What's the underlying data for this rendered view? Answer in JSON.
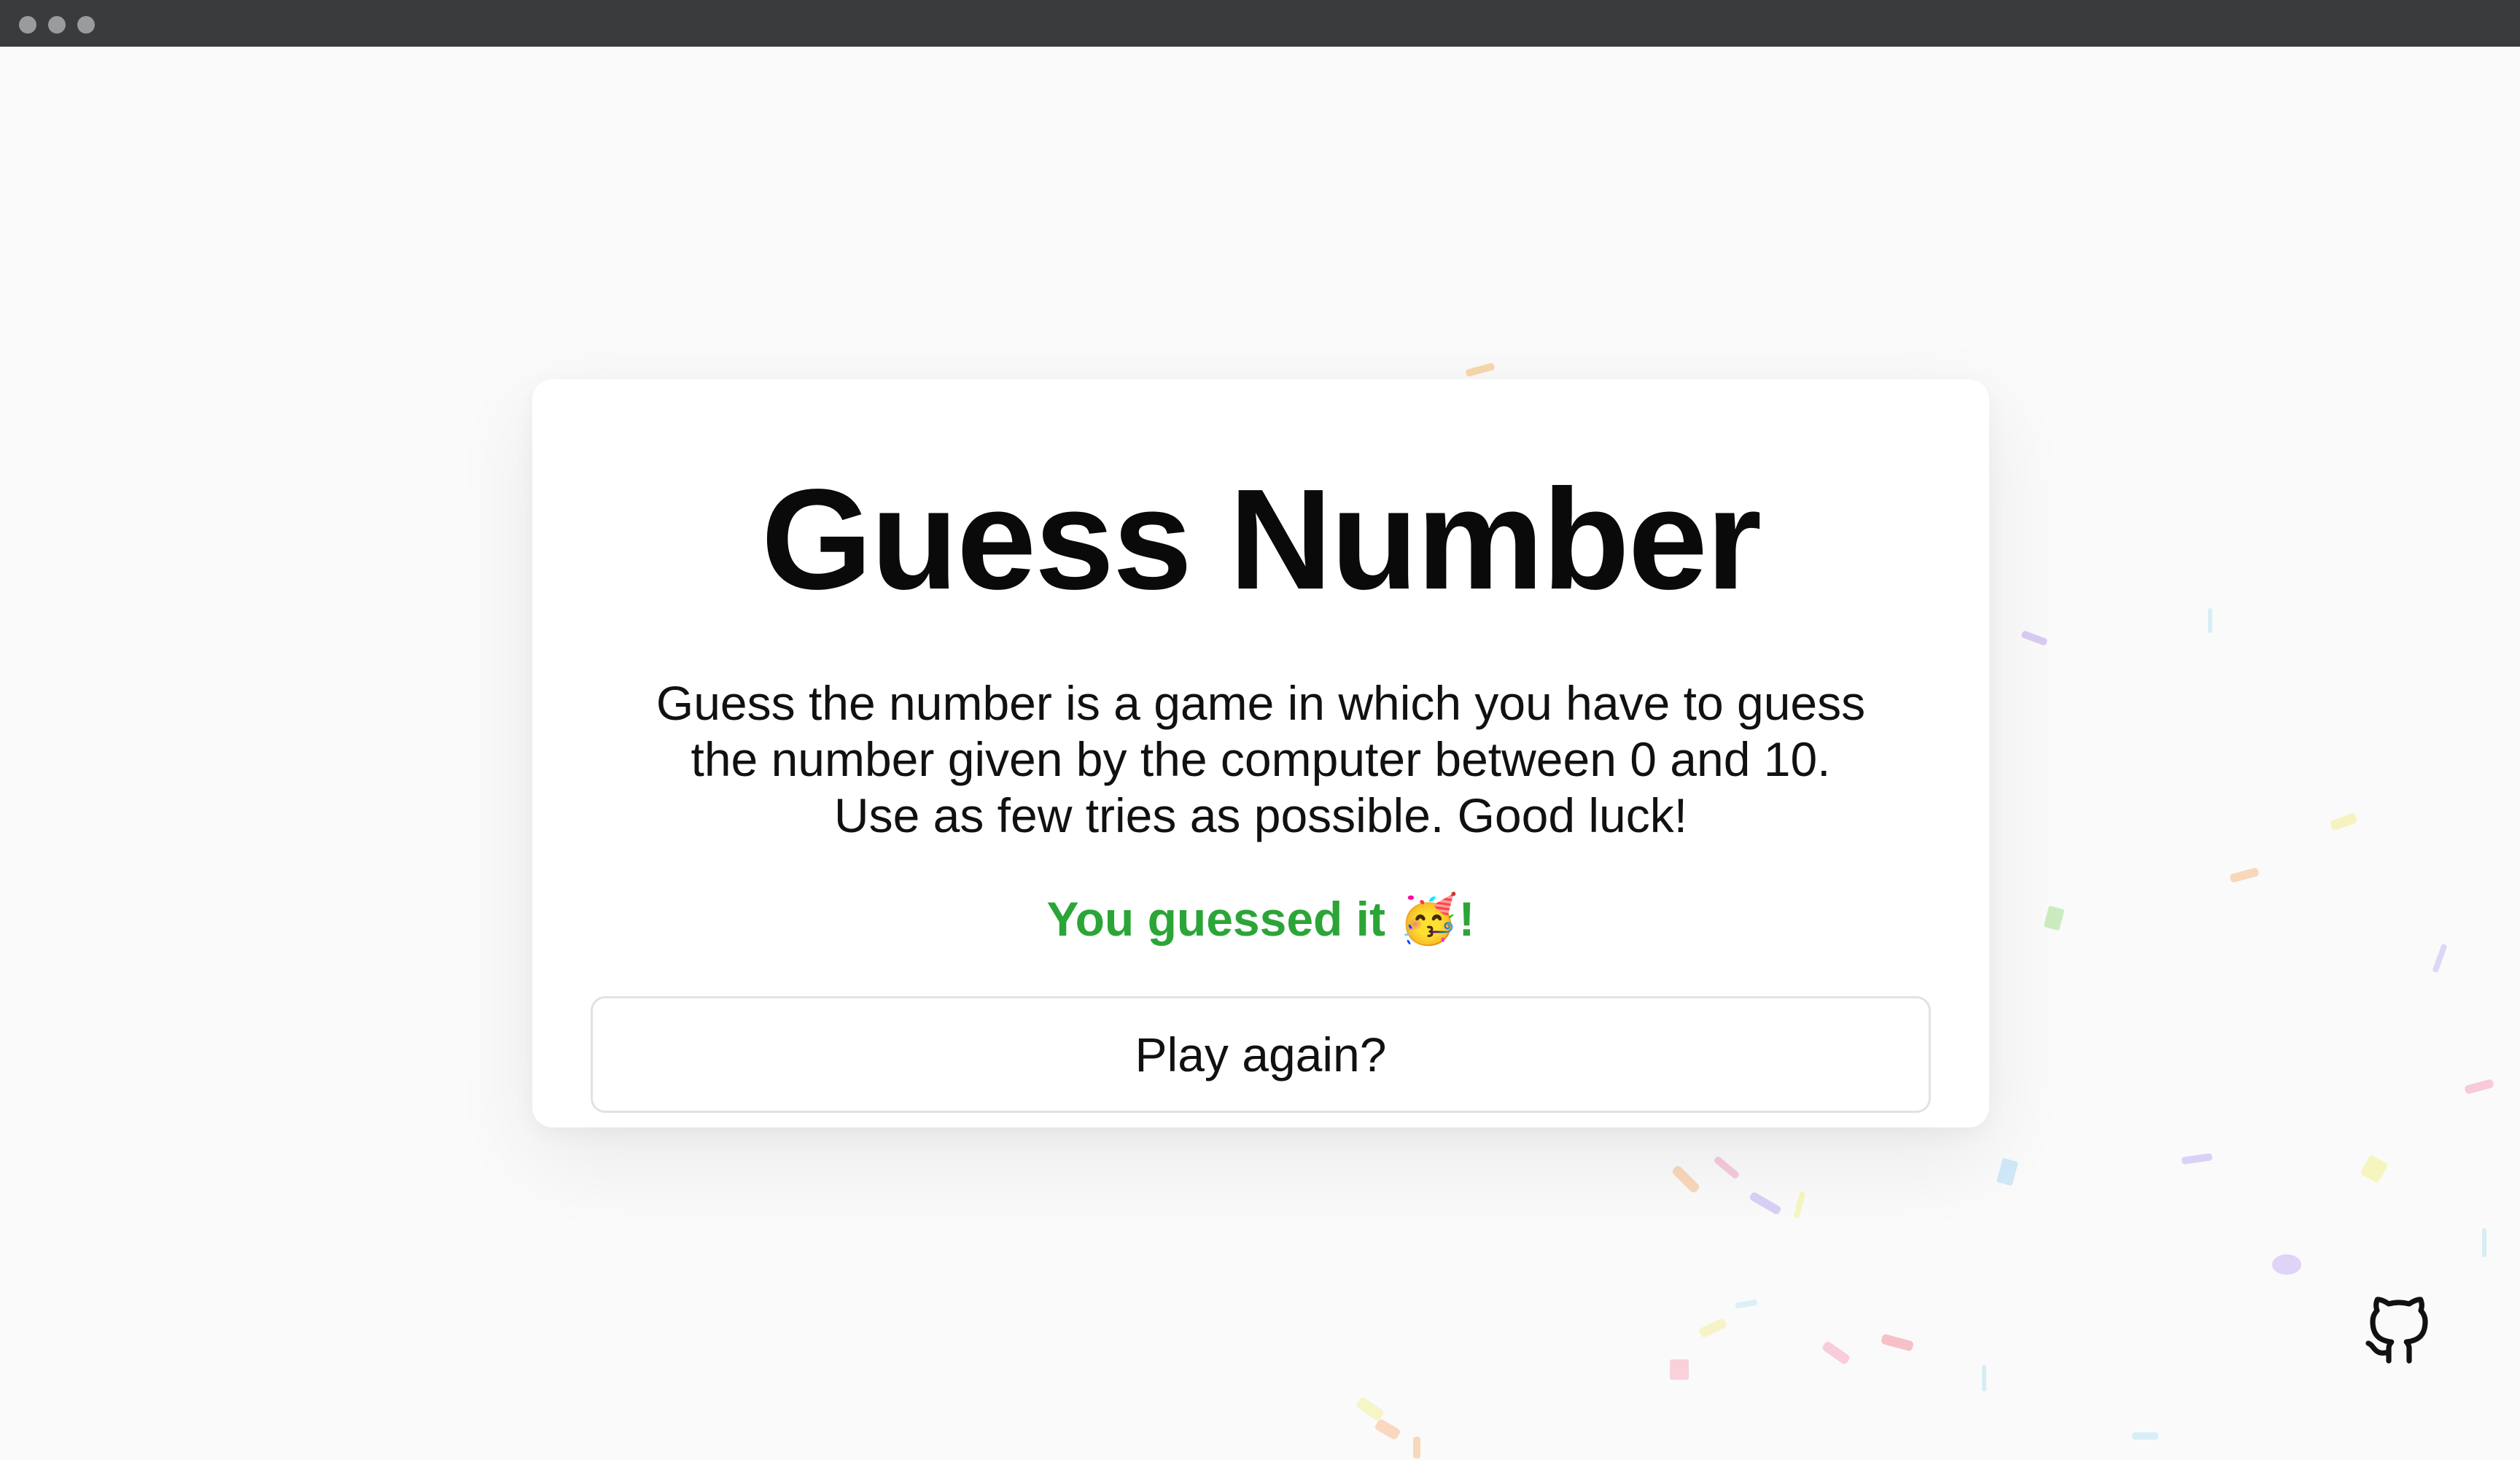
{
  "window": {
    "controls": [
      "close",
      "minimize",
      "maximize"
    ]
  },
  "game": {
    "title": "Guess Number",
    "description_lines": [
      "Guess the number is a game in which you have to guess",
      "the number given by the computer between 0 and 10.",
      "Use as few tries as possible. Good luck!"
    ],
    "result_text": "You guessed it",
    "result_emoji": "🥳",
    "result_suffix": "!",
    "result_color": "#2ba537",
    "play_again_label": "Play again?"
  },
  "footer": {
    "github_icon": "github-icon"
  },
  "colors": {
    "background": "#fafafa",
    "card": "#ffffff",
    "titlebar": "#3a3b3d",
    "success": "#2ba537"
  }
}
